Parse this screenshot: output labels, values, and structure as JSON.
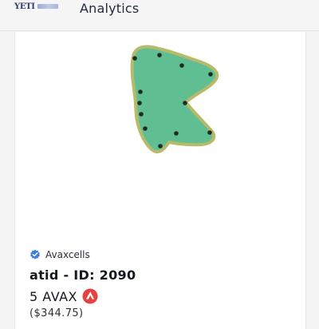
{
  "header": {
    "logo_text": "YETI",
    "title": "Analytics"
  },
  "nft": {
    "collection": "Avaxcells",
    "verified_icon": "verified-check-icon",
    "name": "atid - ID: 2090",
    "price": "5 AVAX",
    "price_icon": "avalanche-logo-icon",
    "price_usd": "($344.75)"
  },
  "colors": {
    "cell_fill": "#5fbf92",
    "cell_outline": "#b7ba69",
    "cell_dots": "#1e2a22",
    "verified": "#3d7ee0",
    "avax_red": "#e84142"
  }
}
